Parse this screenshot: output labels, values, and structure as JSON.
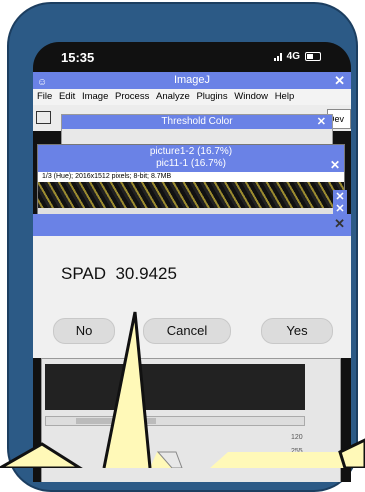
{
  "status": {
    "time": "15:35",
    "network": "4G"
  },
  "imagej": {
    "title": "ImageJ",
    "menu": [
      "File",
      "Edit",
      "Image",
      "Process",
      "Analyze",
      "Plugins",
      "Window",
      "Help"
    ],
    "dev_label": "Dev"
  },
  "threshold": {
    "title": "Threshold Color"
  },
  "pic": {
    "title1": "picture1-2 (16.7%)",
    "title2": "pic11-1 (16.7%)",
    "info": "1/3 (Hue); 2016x1512 pixels; 8-bit; 8.7MB"
  },
  "dialog": {
    "message": "SPAD  30.9425",
    "no_label": "No",
    "cancel_label": "Cancel",
    "yes_label": "Yes"
  },
  "sliders": {
    "val1": "120",
    "val2": "255"
  },
  "colors": {
    "phone": "#2c5a86",
    "titlebar": "#6a82e6",
    "callout": "#fff9b8"
  }
}
